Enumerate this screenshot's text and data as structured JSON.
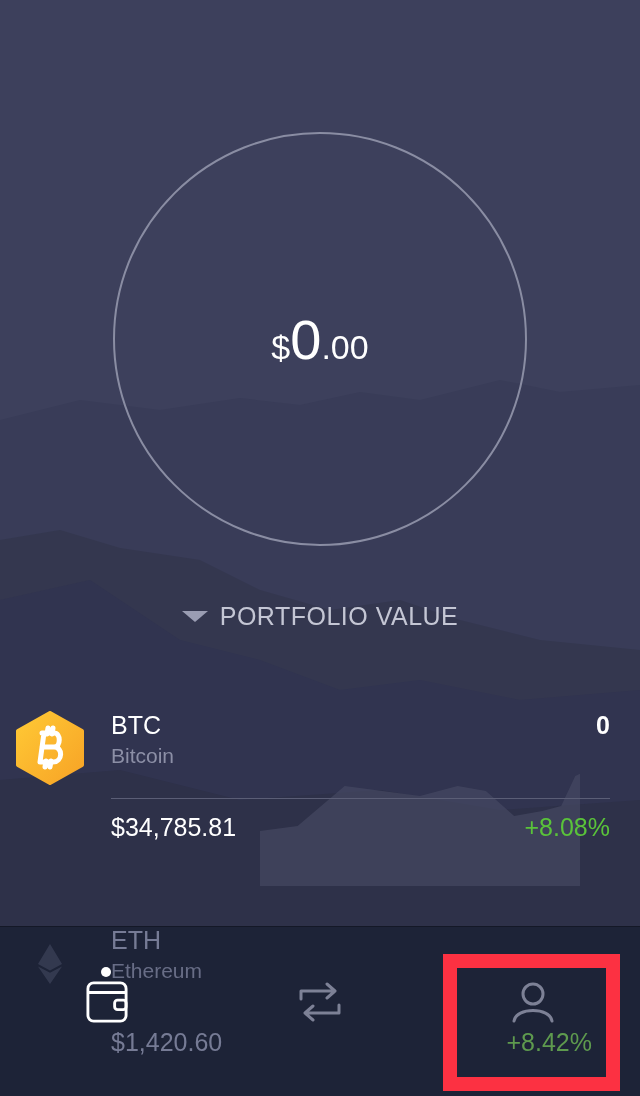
{
  "portfolio": {
    "currency": "$",
    "whole": "0",
    "cents": ".00",
    "label": "PORTFOLIO VALUE"
  },
  "assets": [
    {
      "kind": "bitcoin",
      "symbol": "BTC",
      "name": "Bitcoin",
      "amount": "0",
      "price": "$34,785.81",
      "change": "+8.08%"
    },
    {
      "kind": "ethereum",
      "symbol": "ETH",
      "name": "Ethereum",
      "price": "$1,420.60",
      "change": "+8.42%"
    }
  ],
  "nav": [
    {
      "kind": "wallet",
      "selected": true,
      "highlighted": false
    },
    {
      "kind": "exchange",
      "selected": false,
      "highlighted": false
    },
    {
      "kind": "profile",
      "selected": false,
      "highlighted": true
    }
  ]
}
